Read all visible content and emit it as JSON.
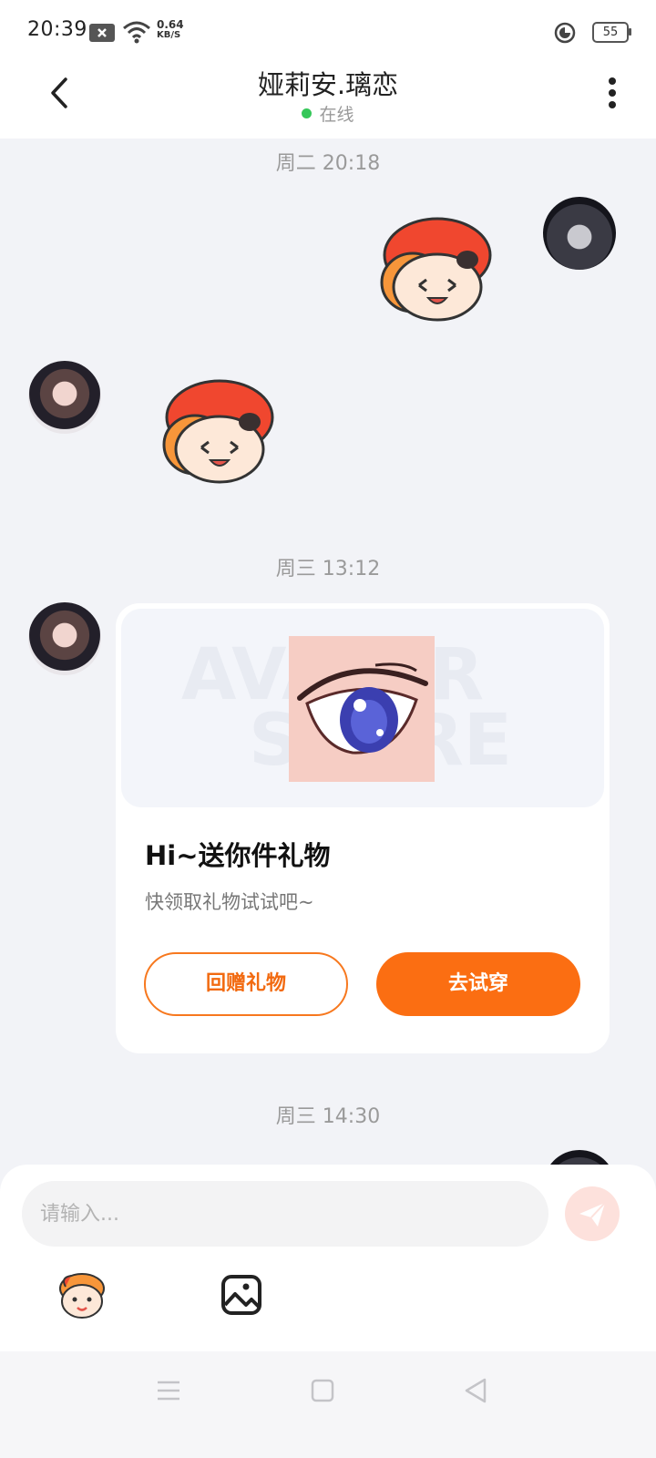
{
  "status_bar": {
    "time": "20:39",
    "net_speed_value": "0.64",
    "net_speed_unit": "KB/S",
    "battery": "55"
  },
  "header": {
    "title": "娅莉安.璃恋",
    "status": "在线"
  },
  "messages": {
    "timestamp_1": "周二 20:18",
    "timestamp_2": "周三 13:12",
    "timestamp_3": "周三 14:30"
  },
  "gift_card": {
    "watermark_line1": "AVATAR",
    "watermark_line2": "STORE",
    "title": "Hi~送你件礼物",
    "subtitle": "快领取礼物试试吧~",
    "return_gift_label": "回赠礼物",
    "try_on_label": "去试穿"
  },
  "composer": {
    "placeholder": "请输入..."
  },
  "colors": {
    "accent": "#fb6e12",
    "online": "#35c759",
    "send_button": "#fde1dc"
  },
  "icons": [
    "back-arrow-icon",
    "more-vertical-icon",
    "send-icon",
    "emoji-mascot-icon",
    "image-icon",
    "menu-icon",
    "home-square-icon",
    "back-triangle-icon",
    "wifi-icon",
    "battery-icon"
  ]
}
